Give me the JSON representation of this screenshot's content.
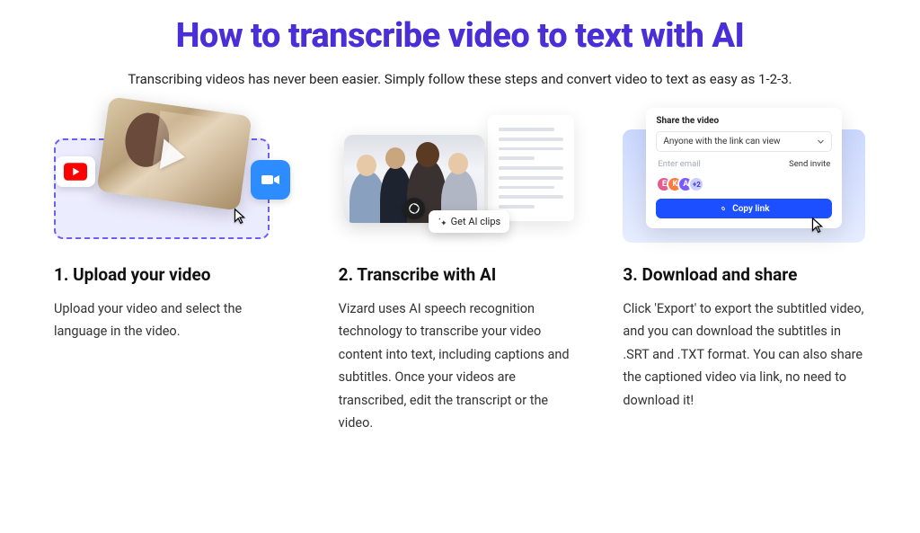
{
  "page_title": "How to transcribe video to text with AI",
  "subtitle": "Transcribing videos has never been easier. Simply follow these steps and convert video to text as easy as 1-2-3.",
  "steps": [
    {
      "title": "1. Upload your video",
      "body": "Upload your video and select the language in the video.",
      "illustration": {
        "badges": [
          "youtube-icon",
          "zoom-icon"
        ],
        "overlay": "play-icon"
      }
    },
    {
      "title": "2. Transcribe with AI",
      "body": "Vizard uses AI speech recognition technology to transcribe your video content into text, including captions and subtitles. Once your videos are transcribed, edit the transcript or the video.",
      "illustration": {
        "chip_label": "Get AI clips",
        "chip_icon": "sparkle-icon",
        "ai_badge": "openai-icon"
      }
    },
    {
      "title": "3. Download and share",
      "body": "Click 'Export' to export the subtitled video, and you can download the subtitles in .SRT and .TXT format. You can also share the captioned video via link, no need to download it!",
      "illustration": {
        "panel_title": "Share the video",
        "select_value": "Anyone with the link can view",
        "email_placeholder": "Enter email",
        "send_label": "Send invite",
        "avatars": [
          "E",
          "K",
          "A",
          "+2"
        ],
        "copy_label": "Copy link"
      }
    }
  ]
}
